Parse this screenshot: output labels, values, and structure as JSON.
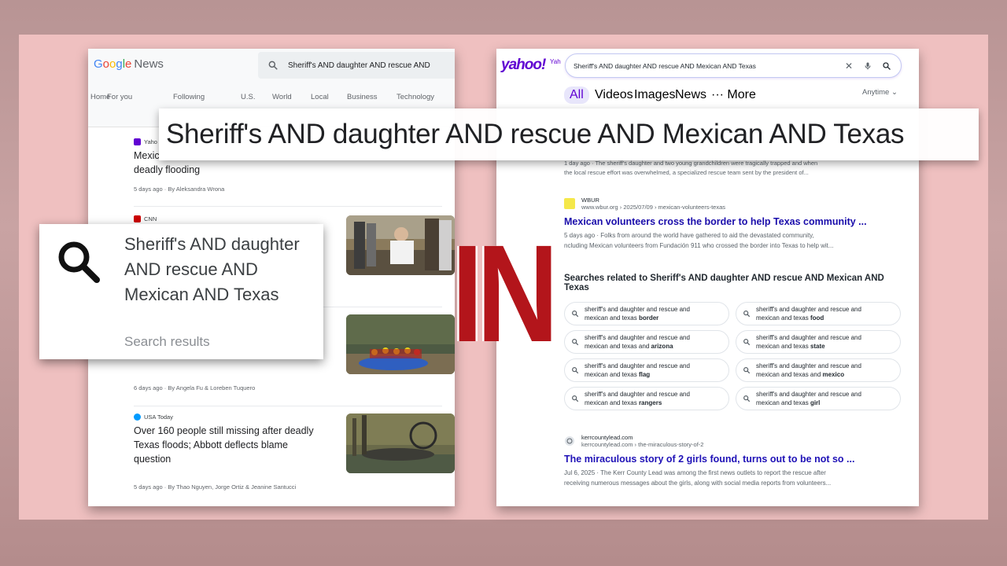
{
  "google_news": {
    "logo": {
      "g1": "G",
      "o1": "o",
      "o2": "o",
      "g2": "g",
      "l": "l",
      "e": "e",
      "news": "News"
    },
    "search_query": "Sheriff's AND daughter AND rescue AND",
    "nav": [
      "Home",
      "For you",
      "Following",
      "U.S.",
      "World",
      "Local",
      "Business",
      "Technology"
    ],
    "articles": [
      {
        "source": "Yaho",
        "title_partial": "Mexic",
        "title_tail": "deadly flooding",
        "meta": "5 days ago · By Aleksandra Wrona",
        "logo_color": "#6001d2"
      },
      {
        "source": "CNN",
        "meta": "",
        "logo_color": "#cc0000"
      },
      {
        "source": "",
        "meta": "6 days ago · By Angela Fu & Loreben Tuquero"
      },
      {
        "source": "USA Today",
        "title": "Over 160 people still missing after deadly Texas floods; Abbott deflects blame question",
        "meta": "5 days ago · By Thao Nguyen, Jorge Ortiz & Jeanine Santucci",
        "logo_color": "#009bff"
      }
    ]
  },
  "yahoo": {
    "logo": "yahoo!",
    "logo_sub": "Yah",
    "search_query": "Sheriff's AND daughter AND rescue AND Mexican AND Texas",
    "tabs": [
      "All",
      "Videos",
      "Images",
      "News",
      "··· More"
    ],
    "anytime": "Anytime ⌄",
    "top_snippet": {
      "line1": "1 day ago · The sheriff's daughter and two young grandchildren were tragically trapped and when",
      "line2": "the local rescue effort was overwhelmed, a specialized rescue team sent by the president of..."
    },
    "result1": {
      "site": "WBUR",
      "url": "www.wbur.org › 2025/07/09 › mexican-volunteers-texas",
      "title": "Mexican volunteers cross the border to help Texas community ...",
      "snippet1": "5 days ago · Folks from around the world have gathered to aid the devastated community,",
      "snippet2": "ncluding Mexican volunteers from Fundación 911 who crossed the border into Texas to help wit..."
    },
    "related_heading": "Searches related to Sheriff's AND daughter AND rescue AND Mexican AND Texas",
    "related": [
      {
        "line1": "sheriff's and daughter and rescue and",
        "line2": "mexican and texas",
        "bold": "border"
      },
      {
        "line1": "sheriff's and daughter and rescue and",
        "line2": "mexican and texas",
        "bold": "food"
      },
      {
        "line1": "sheriff's and daughter and rescue and",
        "line2": "mexican and texas and",
        "bold": "arizona"
      },
      {
        "line1": "sheriff's and daughter and rescue and",
        "line2": "mexican and texas",
        "bold": "state"
      },
      {
        "line1": "sheriff's and daughter and rescue and",
        "line2": "mexican and texas",
        "bold": "flag"
      },
      {
        "line1": "sheriff's and daughter and rescue and",
        "line2": "mexican and texas and",
        "bold": "mexico"
      },
      {
        "line1": "sheriff's and daughter and rescue and",
        "line2": "mexican and texas",
        "bold": "rangers"
      },
      {
        "line1": "sheriff's and daughter and rescue and",
        "line2": "mexican and texas",
        "bold": "girl"
      }
    ],
    "result2": {
      "site": "kerrcountylead.com",
      "url": "kerrcountylead.com › the-miraculous-story-of-2",
      "title": "The miraculous story of 2 girls found, turns out to be not so ...",
      "snippet1": "Jul 6, 2025 · The Kerr County Lead was among the first news outlets to report the rescue after",
      "snippet2": "receiving numerous messages about the girls, along with social media reports from volunteers..."
    }
  },
  "overlay": {
    "banner": "Sheriff's AND daughter AND rescue AND Mexican AND Texas",
    "popup_query": "Sheriff's AND daughter AND rescue AND Mexican AND Texas",
    "popup_sub": "Search results",
    "big_word": "IN",
    "big_word_color": "#b3151b"
  }
}
